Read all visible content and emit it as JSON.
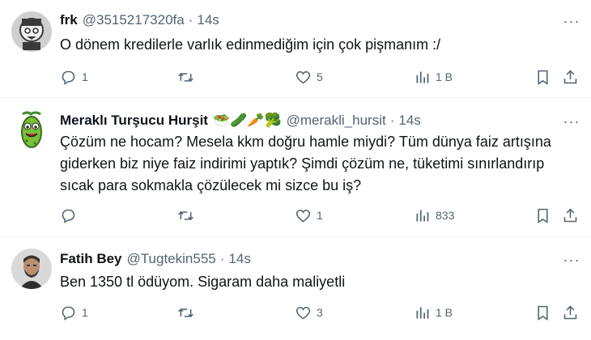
{
  "tweets": [
    {
      "name": "frk",
      "emoji": "",
      "handle": "@3515217320fa",
      "time": "14s",
      "text": "O dönem  kredilerle varlık edinmediğim için çok pişmanım :/",
      "replies": "1",
      "retweets": "",
      "likes": "5",
      "views": "1 B"
    },
    {
      "name": "Meraklı Turşucu Hurşit",
      "emoji": "🥗🥒🥕🥦",
      "handle": "@merakli_hursit",
      "time": "14s",
      "text": "Çözüm ne hocam? Mesela kkm doğru hamle miydi? Tüm dünya faiz artışına giderken biz niye faiz indirimi yaptık? Şimdi çözüm ne, tüketimi sınırlandırıp sıcak para sokmakla çözülecek mi sizce bu iş?",
      "replies": "",
      "retweets": "",
      "likes": "1",
      "views": "833"
    },
    {
      "name": "Fatih Bey",
      "emoji": "",
      "handle": "@Tugtekin555",
      "time": "14s",
      "text": "Ben 1350 tl ödüyom. Sigaram daha maliyetli",
      "replies": "1",
      "retweets": "",
      "likes": "3",
      "views": "1 B"
    }
  ],
  "separator": "·",
  "more_glyph": "···",
  "icons": [
    "reply-icon",
    "retweet-icon",
    "like-icon",
    "views-icon",
    "bookmark-icon",
    "share-icon",
    "more-icon"
  ],
  "colors": {
    "text": "#0f1419",
    "muted": "#536471",
    "divider": "#eff3f4"
  }
}
